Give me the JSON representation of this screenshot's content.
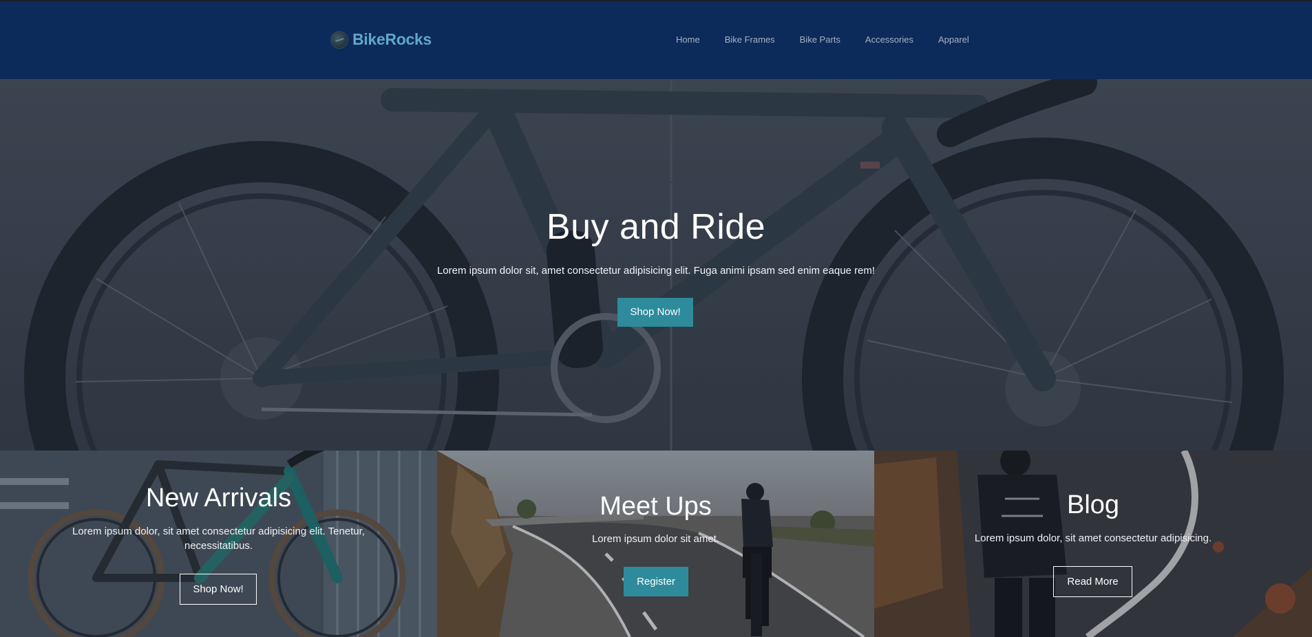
{
  "header": {
    "brand": "BikeRocks",
    "nav": [
      "Home",
      "Bike Frames",
      "Bike Parts",
      "Accessories",
      "Apparel"
    ]
  },
  "hero": {
    "title": "Buy and Ride",
    "text": "Lorem ipsum dolor sit, amet consectetur adipisicing elit. Fuga animi ipsam sed enim eaque rem!",
    "button": "Shop Now!"
  },
  "cards": [
    {
      "title": "New Arrivals",
      "text": "Lorem ipsum dolor, sit amet consectetur adipisicing elit. Tenetur, necessitatibus.",
      "button": "Shop Now!"
    },
    {
      "title": "Meet Ups",
      "text": "Lorem ipsum dolor sit amet.",
      "button": "Register"
    },
    {
      "title": "Blog",
      "text": "Lorem ipsum dolor, sit amet consectetur adipisicing.",
      "button": "Read More"
    }
  ],
  "colors": {
    "header_bg": "#0c2a5a",
    "brand": "#5fa9c8",
    "accent": "#2e8b9b"
  }
}
